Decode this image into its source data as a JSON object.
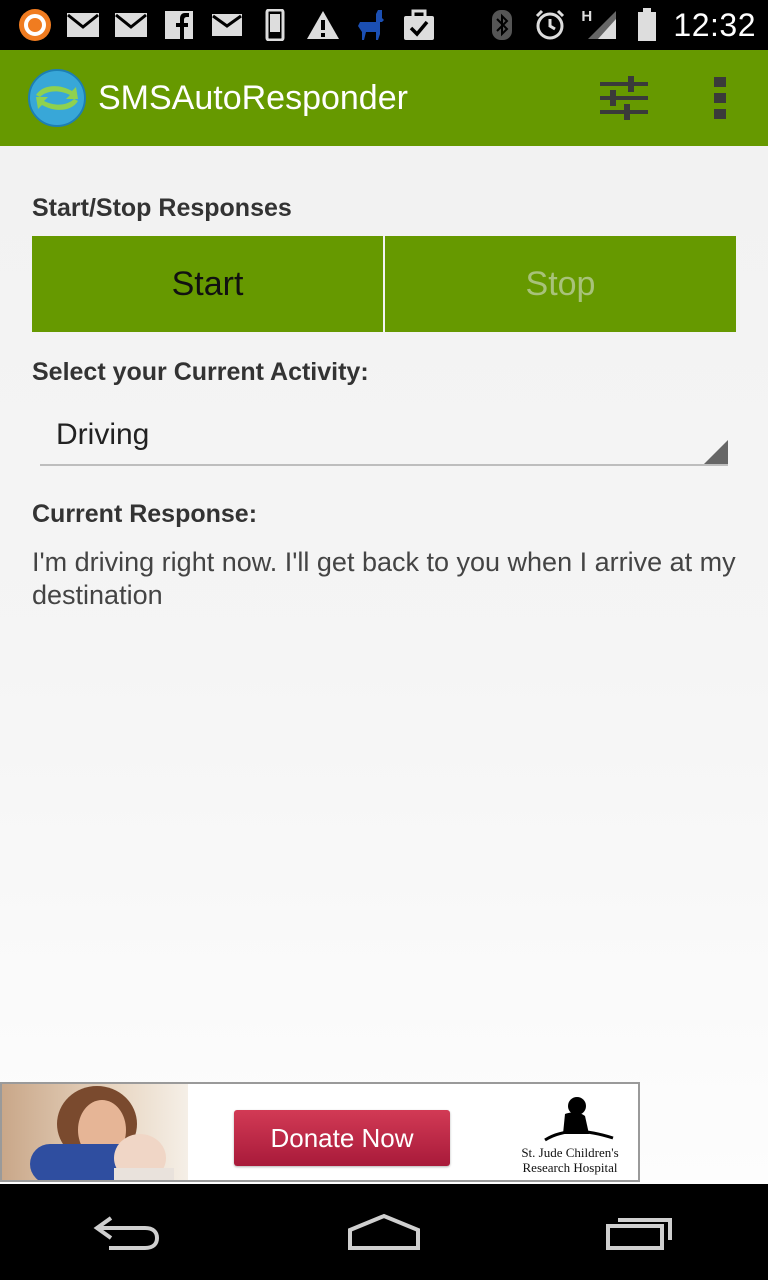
{
  "status_bar": {
    "time": "12:32",
    "network_type": "H",
    "icons": [
      "avast-icon",
      "gmail-icon",
      "gmail-icon",
      "facebook-icon",
      "mail-icon",
      "phone-icon",
      "warning-icon",
      "llama-icon",
      "task-check-icon",
      "bluetooth-icon",
      "alarm-icon",
      "signal-icon",
      "battery-icon"
    ]
  },
  "action_bar": {
    "title": "SMSAutoResponder",
    "actions": [
      "settings-sliders-icon",
      "overflow-menu-icon"
    ],
    "color": "#669900"
  },
  "main": {
    "start_stop_label": "Start/Stop Responses",
    "start_button": "Start",
    "stop_button": "Stop",
    "activity_label": "Select your Current Activity:",
    "activity_selected": "Driving",
    "response_label": "Current Response:",
    "response_text": "I'm driving right now. I'll get back to you when I arrive at my destination"
  },
  "ad": {
    "button": "Donate Now",
    "logo_line1": "St. Jude Children's",
    "logo_line2": "Research Hospital"
  },
  "nav_bar": {
    "icons": [
      "back-icon",
      "home-icon",
      "recent-apps-icon"
    ]
  }
}
